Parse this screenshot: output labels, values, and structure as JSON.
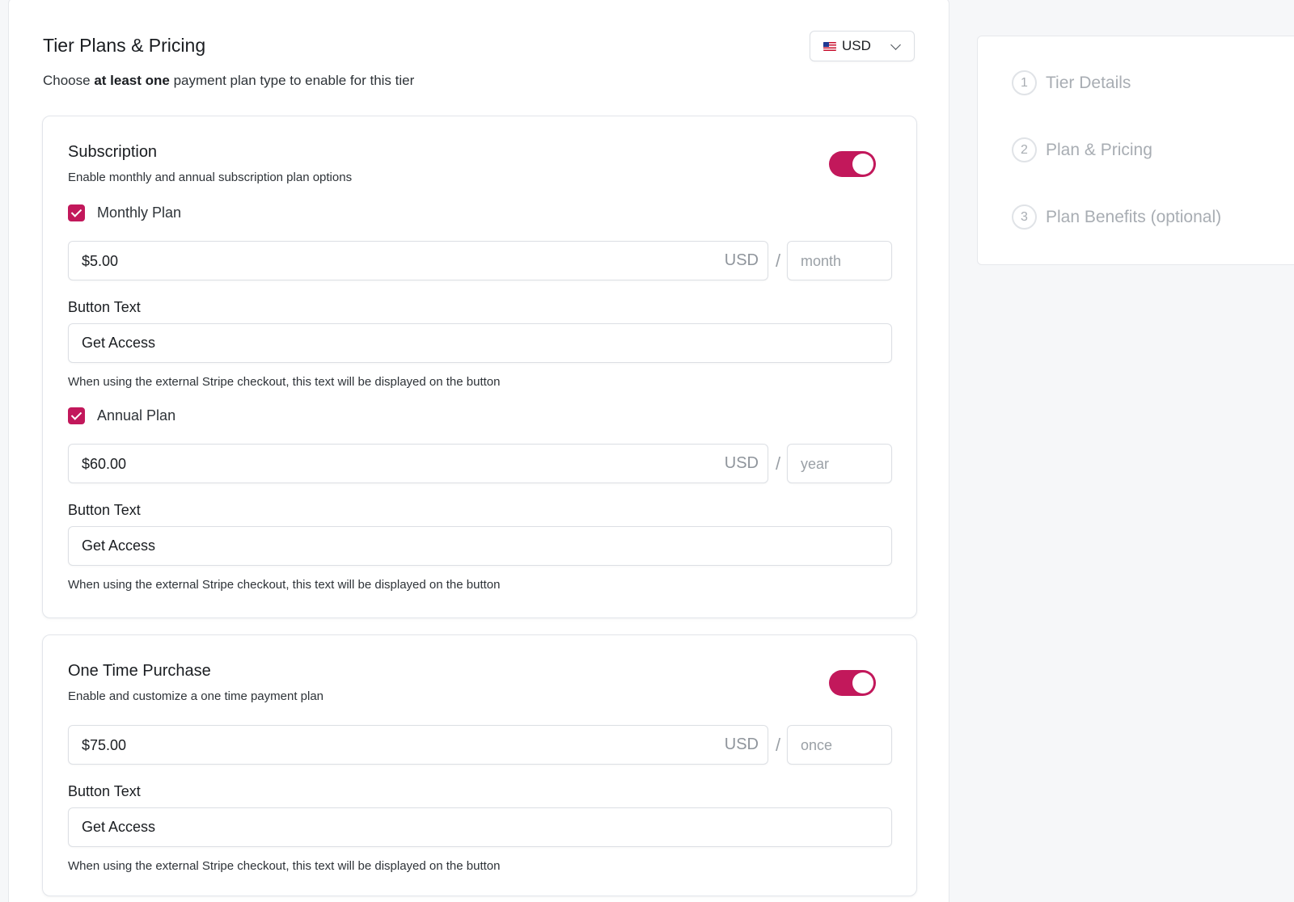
{
  "header": {
    "title": "Tier Plans & Pricing",
    "subtitle_pre": "Choose ",
    "subtitle_bold": "at least one",
    "subtitle_post": " payment plan type to enable for this tier",
    "currency_label": "USD"
  },
  "subscription": {
    "title": "Subscription",
    "description": "Enable monthly and annual subscription plan options",
    "enabled": true,
    "monthly": {
      "checked": true,
      "label": "Monthly Plan",
      "price": "$5.00",
      "currency": "USD",
      "slash": "/",
      "period": "month",
      "button_text_label": "Button Text",
      "button_text_value": "Get Access",
      "help": "When using the external Stripe checkout, this text will be displayed on the button"
    },
    "annual": {
      "checked": true,
      "label": "Annual Plan",
      "price": "$60.00",
      "currency": "USD",
      "slash": "/",
      "period": "year",
      "button_text_label": "Button Text",
      "button_text_value": "Get Access",
      "help": "When using the external Stripe checkout, this text will be displayed on the button"
    }
  },
  "one_time": {
    "title": "One Time Purchase",
    "description": "Enable and customize a one time payment plan",
    "enabled": true,
    "price": "$75.00",
    "currency": "USD",
    "slash": "/",
    "period": "once",
    "button_text_label": "Button Text",
    "button_text_value": "Get Access",
    "help": "When using the external Stripe checkout, this text will be displayed on the button"
  },
  "steps": [
    {
      "num": "1",
      "label": "Tier Details"
    },
    {
      "num": "2",
      "label": "Plan & Pricing"
    },
    {
      "num": "3",
      "label": "Plan Benefits (optional)"
    }
  ],
  "colors": {
    "accent": "#c2185b",
    "muted": "#a8adb3",
    "border": "#dcdfe4"
  }
}
